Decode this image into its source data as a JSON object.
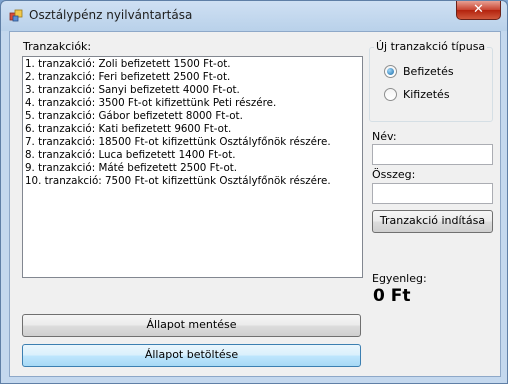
{
  "window": {
    "title": "Osztálypénz nyilvántartása",
    "close_glyph": "✕",
    "icon": "app-icon"
  },
  "transactions": {
    "label": "Tranzakciók:",
    "items": [
      "1. tranzakció: Zoli befizetett 1500 Ft-ot.",
      "2. tranzakció: Feri befizetett 2500 Ft-ot.",
      "3. tranzakció: Sanyi befizetett 4000 Ft-ot.",
      "4. tranzakció: 3500 Ft-ot kifizettünk Peti részére.",
      "5. tranzakció: Gábor befizetett 8000 Ft-ot.",
      "6. tranzakció: Kati befizetett 9600 Ft-ot.",
      "7. tranzakció: 18500 Ft-ot kifizettünk Osztályfőnök részére.",
      "8. tranzakció: Luca befizetett 1400 Ft-ot.",
      "9. tranzakció: Máté befizetett 2500 Ft-ot.",
      "10. tranzakció: 7500 Ft-ot kifizettünk Osztályfőnök részére."
    ]
  },
  "type_group": {
    "title": "Új tranzakció típusa",
    "options": [
      {
        "label": "Befizetés",
        "checked": true
      },
      {
        "label": "Kifizetés",
        "checked": false
      }
    ]
  },
  "form": {
    "name_label": "Név:",
    "name_value": "",
    "amount_label": "Összeg:",
    "amount_value": "",
    "start_button": "Tranzakció indítása"
  },
  "balance": {
    "label": "Egyenleg:",
    "value": "0 Ft"
  },
  "buttons": {
    "save_state": "Állapot mentése",
    "load_state": "Állapot betöltése"
  }
}
